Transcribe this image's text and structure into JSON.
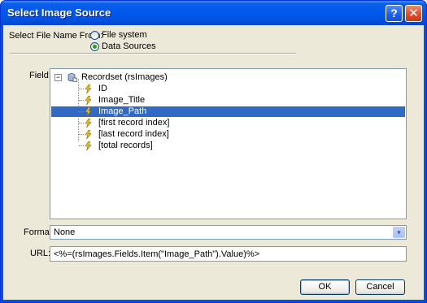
{
  "window": {
    "title": "Select Image Source",
    "help_glyph": "?",
    "close_glyph": "✕"
  },
  "source": {
    "label": "Select File Name From:",
    "options": [
      {
        "label": "File system",
        "checked": false
      },
      {
        "label": "Data Sources",
        "checked": true
      }
    ]
  },
  "field": {
    "label": "Field:",
    "root": {
      "label": "Recordset (rsImages)",
      "expander": "−"
    },
    "items": [
      {
        "label": "ID",
        "selected": false
      },
      {
        "label": "Image_Title",
        "selected": false
      },
      {
        "label": "Image_Path",
        "selected": true
      },
      {
        "label": "[first record index]",
        "selected": false
      },
      {
        "label": "[last record index]",
        "selected": false
      },
      {
        "label": "[total records]",
        "selected": false
      }
    ]
  },
  "format": {
    "label": "Format:",
    "value": "None",
    "arrow": "▾"
  },
  "url": {
    "label": "URL:",
    "value": "<%=(rsImages.Fields.Item(\"Image_Path\").Value)%>"
  },
  "buttons": {
    "ok": "OK",
    "cancel": "Cancel"
  },
  "colors": {
    "title_bar": "#0058ee",
    "selection": "#316ac5",
    "dialog_face": "#ece9d8"
  }
}
